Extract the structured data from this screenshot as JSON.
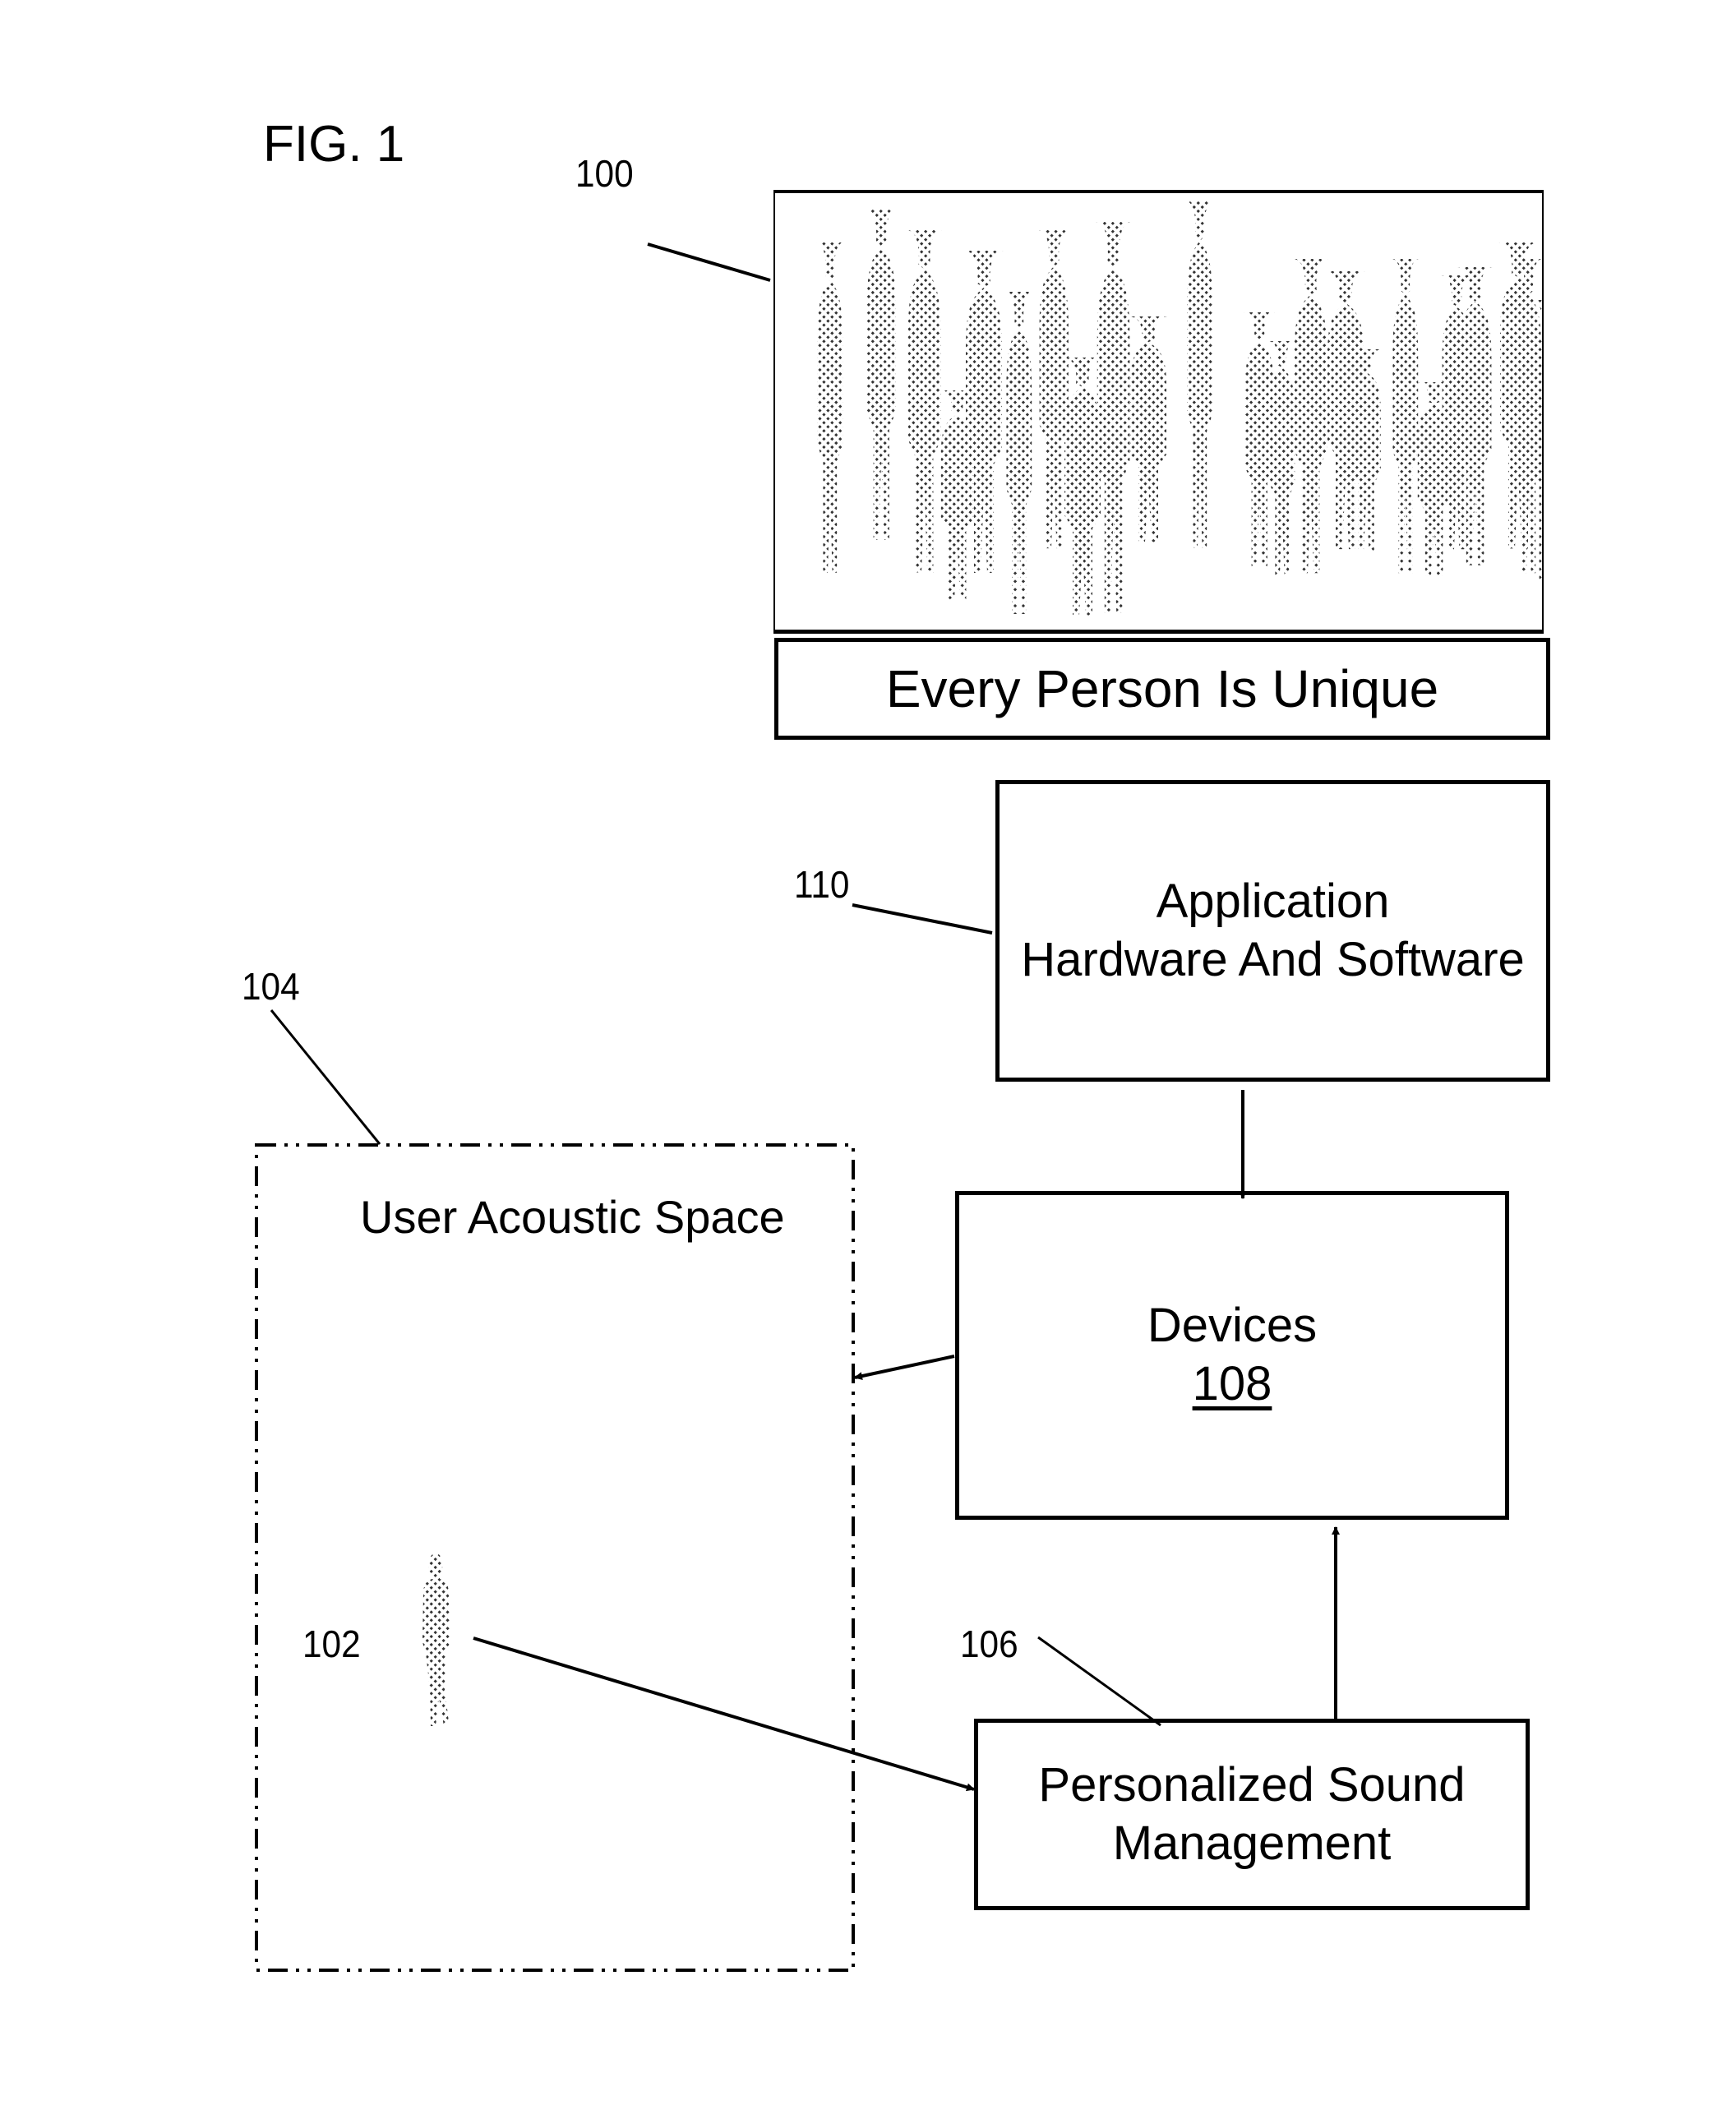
{
  "figure": {
    "title": "FIG. 1"
  },
  "reference_labels": {
    "crowd": "100",
    "user": "102",
    "acoustic_space": "104",
    "sound_management": "106",
    "application": "110"
  },
  "crowd_panel": {
    "image_icon": "crowd-silhouettes",
    "caption": "Every Person Is Unique"
  },
  "application_box": {
    "line1": "Application",
    "line2": "Hardware And Software"
  },
  "devices_box": {
    "title": "Devices",
    "ref": "108"
  },
  "sound_management_box": {
    "line1": "Personalized Sound",
    "line2": "Management"
  },
  "acoustic_space_box": {
    "title": "User Acoustic Space",
    "person_icon": "person-silhouette"
  },
  "connections": [
    {
      "from": "application_box",
      "to": "devices_box"
    },
    {
      "from": "devices_box",
      "to": "acoustic_space_box"
    },
    {
      "from": "sound_management_box",
      "to": "devices_box"
    },
    {
      "from": "user",
      "to": "sound_management_box"
    }
  ]
}
